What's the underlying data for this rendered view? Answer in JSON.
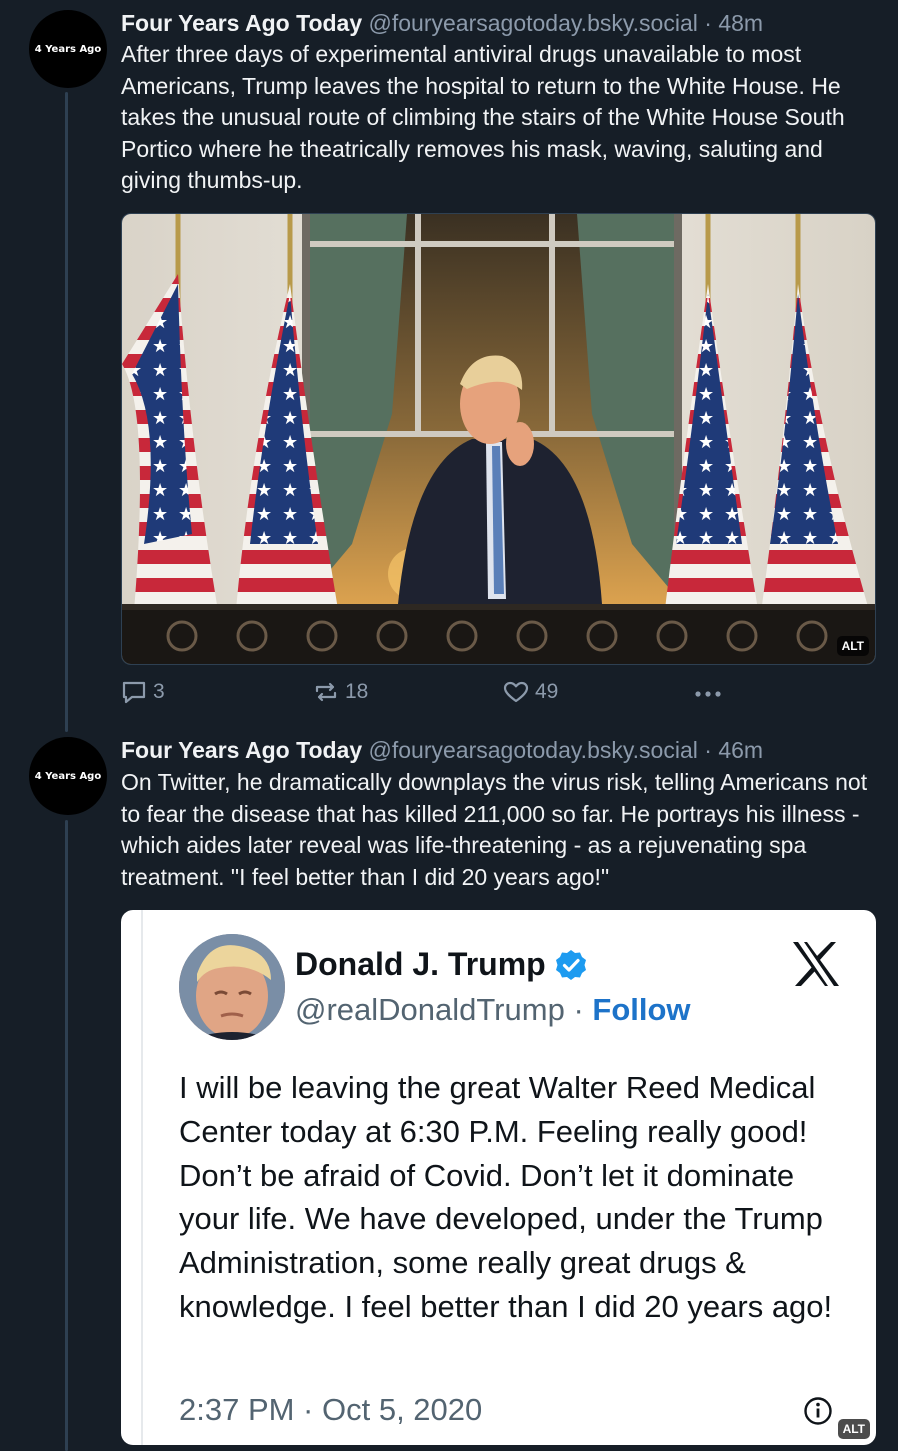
{
  "posts": [
    {
      "avatar_text": "4 Years Ago",
      "author": "Four Years Ago Today",
      "handle": "@fouryearsagotoday.bsky.social",
      "separator": "·",
      "time": "48m",
      "text": "After three days of experimental antiviral drugs unavailable to most Americans, Trump leaves the hospital to return to the White House. He takes the unusual route of climbing the stairs of the White House South Portico where he theatrically removes his mask, waving, saluting and giving thumbs-up.",
      "image_alt_badge": "ALT",
      "replies": "3",
      "reposts": "18",
      "likes": "49"
    },
    {
      "avatar_text": "4 Years Ago",
      "author": "Four Years Ago Today",
      "handle": "@fouryearsagotoday.bsky.social",
      "separator": "·",
      "time": "46m",
      "text": "On Twitter, he dramatically downplays the virus risk, telling Americans not to fear the disease that has killed 211,000 so far. He portrays his illness - which aides later reveal was life-threatening - as a rejuvenating spa treatment. \"I feel better than I did 20 years ago!\"",
      "image_alt_badge": "ALT"
    }
  ],
  "embedded_tweet": {
    "name": "Donald J. Trump",
    "handle": "@realDonaldTrump",
    "separator": "·",
    "follow_label": "Follow",
    "text": "I will be leaving the great Walter Reed Medical Center today at 6:30 P.M. Feeling really good! Don’t be afraid of Covid. Don’t let it dominate your life. We have developed, under the Trump Administration, some really great drugs & knowledge. I feel better than I did 20 years ago!",
    "date": "2:37 PM · Oct 5, 2020"
  },
  "colors": {
    "background": "#161e27",
    "secondary_text": "#8c9aab",
    "verified_badge": "#1d9bf0",
    "follow_link": "#1d73c9"
  },
  "icons": [
    "reply-icon",
    "repost-icon",
    "like-icon",
    "more-options-icon",
    "verified-badge-icon",
    "x-logo-icon",
    "info-icon"
  ]
}
